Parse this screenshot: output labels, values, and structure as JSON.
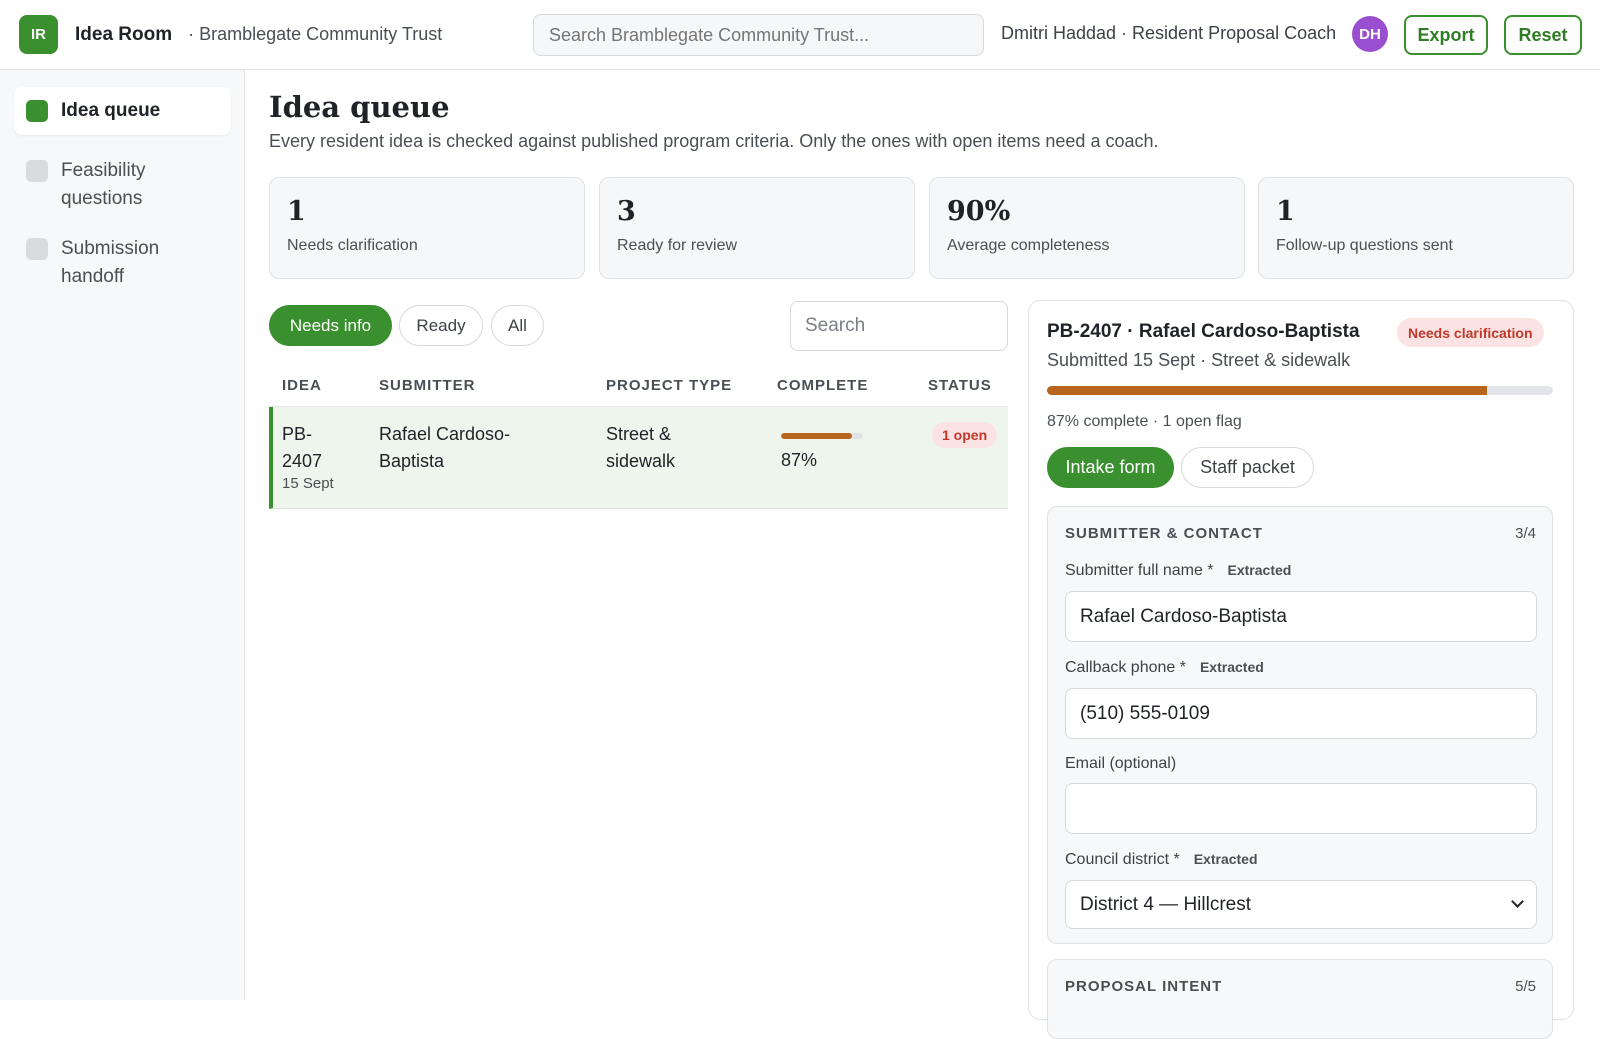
{
  "header": {
    "logo_text": "IR",
    "app_name": "Idea Room",
    "org_name": "· Bramblegate Community Trust",
    "search_placeholder": "Search Bramblegate Community Trust...",
    "user_label": "Dmitri Haddad · Resident Proposal Coach",
    "avatar_initials": "DH",
    "export_label": "Export",
    "reset_label": "Reset"
  },
  "sidebar": {
    "items": [
      {
        "label": "Idea queue",
        "active": true
      },
      {
        "label": "Feasibility questions",
        "active": false
      },
      {
        "label": "Submission handoff",
        "active": false
      }
    ]
  },
  "main": {
    "title": "Idea queue",
    "subtitle": "Every resident idea is checked against published program criteria. Only the ones with open items need a coach.",
    "stats": [
      {
        "value": "1",
        "label": "Needs clarification"
      },
      {
        "value": "3",
        "label": "Ready for review"
      },
      {
        "value": "90%",
        "label": "Average completeness"
      },
      {
        "value": "1",
        "label": "Follow-up questions sent"
      }
    ],
    "filters": [
      "Needs info",
      "Ready",
      "All"
    ],
    "active_filter": "Needs info",
    "search_placeholder": "Search",
    "columns": [
      "IDEA",
      "SUBMITTER",
      "PROJECT TYPE",
      "COMPLETE",
      "STATUS"
    ],
    "rows": [
      {
        "id_line1": "PB-",
        "id_line2": "2407",
        "date": "15 Sept",
        "submitter_line1": "Rafael Cardoso-",
        "submitter_line2": "Baptista",
        "type_line1": "Street &",
        "type_line2": "sidewalk",
        "complete": 0.87,
        "complete_label": "87%",
        "status": "1 open"
      }
    ]
  },
  "detail": {
    "title": "PB-2407 · Rafael Cardoso-Baptista",
    "badge": "Needs clarification",
    "subtitle": "Submitted 15 Sept · Street & sidewalk",
    "progress": 0.87,
    "progress_label": "87% complete · 1 open flag",
    "tabs": [
      "Intake form",
      "Staff packet"
    ],
    "active_tab": "Intake form",
    "sections": [
      {
        "heading": "SUBMITTER & CONTACT",
        "count": "3/4",
        "fields": [
          {
            "label": "Submitter full name *",
            "tag": "Extracted",
            "value": "Rafael Cardoso-Baptista"
          },
          {
            "label": "Callback phone *",
            "tag": "Extracted",
            "value": "(510) 555-0109"
          },
          {
            "label": "Email (optional)",
            "tag": "",
            "value": ""
          },
          {
            "label": "Council district *",
            "tag": "Extracted",
            "value": "District 4 — Hillcrest"
          }
        ]
      },
      {
        "heading": "PROPOSAL INTENT",
        "count": "5/5"
      }
    ]
  },
  "colors": {
    "accent": "#3a8f2e",
    "progress": "#b8661e",
    "alert": "#c0392b",
    "avatar": "#9a4fd0"
  }
}
